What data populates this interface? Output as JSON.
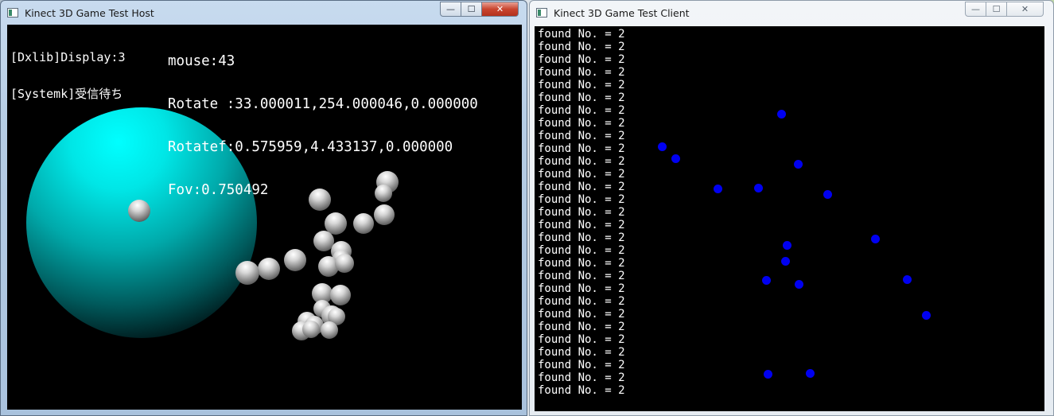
{
  "host_window": {
    "title": "Kinect 3D Game Test Host",
    "hud_left": [
      "[Dxlib]Display:3",
      "[Systemk]受信待ち"
    ],
    "hud_right": [
      "mouse:43",
      "Rotate :33.000011,254.000046,0.000000",
      "Rotatef:0.575959,4.433137,0.000000",
      "Fov:0.750492"
    ],
    "sphere_color": "#00ffff",
    "balls_count": 25
  },
  "client_window": {
    "title": "Kinect 3D Game Test Client",
    "log_text": "found No. = 2",
    "log_line_count": 29,
    "joint_color": "#0000f0"
  },
  "caption_buttons": {
    "minimize": "—",
    "maximize": "☐",
    "close": "✕"
  }
}
